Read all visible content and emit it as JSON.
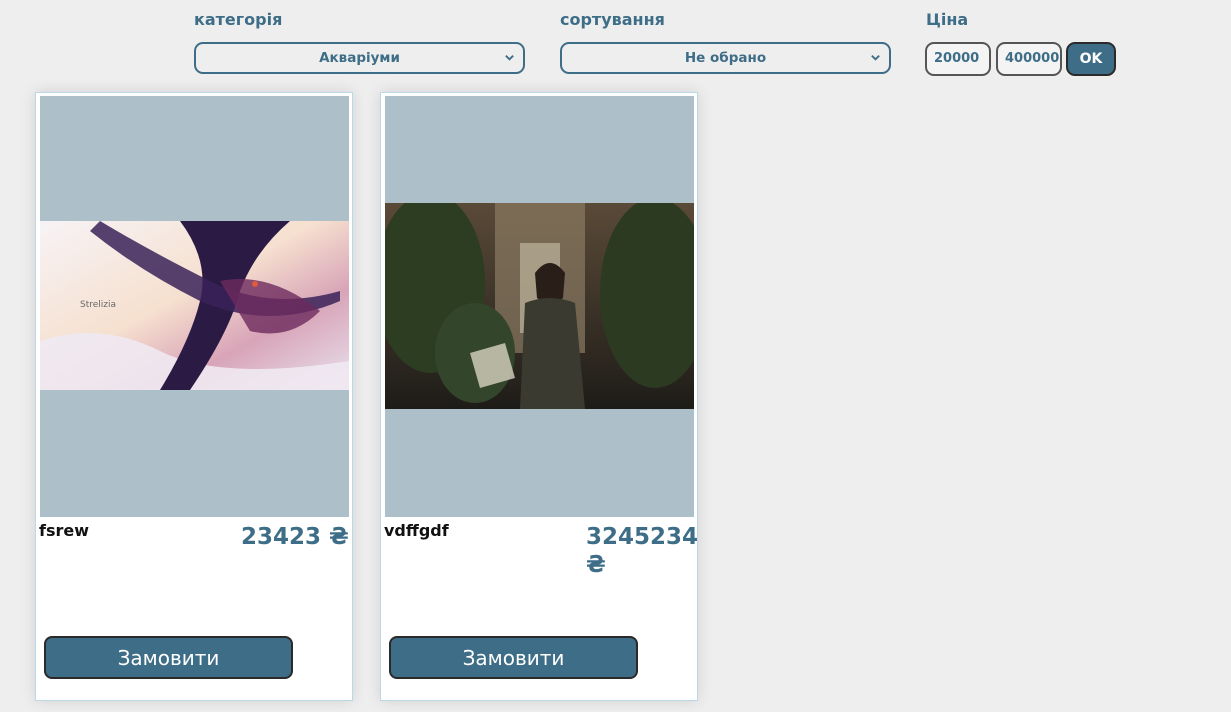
{
  "filters": {
    "category_label": "категорія",
    "category_value": "Акваріуми",
    "sort_label": "сортування",
    "sort_value": "Не обрано",
    "price_label": "Ціна",
    "price_min": "20000",
    "price_max": "400000",
    "ok_label": "OK"
  },
  "products": [
    {
      "name": "fsrew",
      "price": "23423 ₴",
      "order_label": "Замовити",
      "image": "anime-art-strelizia-image"
    },
    {
      "name": "vdffgdf",
      "price_line1": "3245234",
      "price_line2": "₴",
      "order_label": "Замовити",
      "image": "anime-girl-alley-image"
    }
  ],
  "colors": {
    "accent": "#3e6d87",
    "image_bg": "#adc0c9",
    "page_bg": "#eeeeee"
  }
}
